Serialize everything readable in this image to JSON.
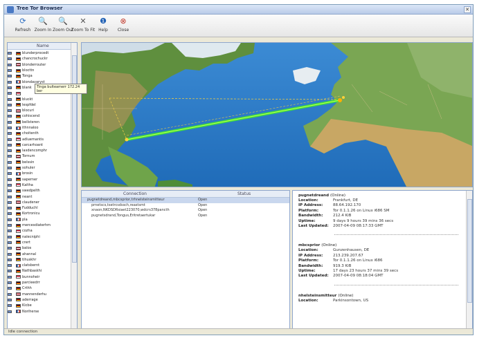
{
  "window": {
    "title": "Tree Tor Browser"
  },
  "toolbar": [
    {
      "label": "Refresh",
      "icon": "refresh-icon",
      "glyph": "⟳",
      "color": "#2e6fc2"
    },
    {
      "label": "Zoom In",
      "icon": "zoom-in-icon",
      "glyph": "🔍",
      "color": "#333"
    },
    {
      "label": "Zoom Out",
      "icon": "zoom-out-icon",
      "glyph": "🔍",
      "color": "#333"
    },
    {
      "label": "Zoom To Fit",
      "icon": "zoom-fit-icon",
      "glyph": "✕",
      "color": "#555"
    },
    {
      "label": "Help",
      "icon": "help-icon",
      "glyph": "❶",
      "color": "#1e5fb4"
    },
    {
      "label": "Close",
      "icon": "close-icon",
      "glyph": "⊗",
      "color": "#c0392b"
    }
  ],
  "routers": {
    "header": "Name",
    "items": [
      "blunderprocedt",
      "chancrochuckr",
      "blonderrouter",
      "blocttn",
      "Tonga",
      "blondavaryst",
      "blank",
      "",
      "bluckt",
      "lespfdel",
      "blocuri",
      "cohiscend",
      "bellsteren",
      "ithnnaloo",
      "choitenth",
      "adluemantis",
      "carcarhoant",
      "laxdencomphr",
      "Tornum",
      "belssin",
      "sohuler",
      "brosin",
      "saperner",
      "Kaltha",
      "swedpelth",
      "neant",
      "claudener",
      "Fudduchl",
      "Kortronicu",
      "pla",
      "mercesdiaterhm",
      "cozha",
      "nalecniphi",
      "crert",
      "balos",
      "ahannal",
      "tihuskhr",
      "clatsbernt",
      "Nathbaskhi",
      "bunnoheir",
      "parcieedrr",
      "Crthh",
      "mannenderhu",
      "aderrage",
      "Kicbe",
      "Noriherse"
    ]
  },
  "tooltip": "Tinga bulteamerr 172.24 ber",
  "connections": {
    "headers": [
      "Connection",
      "Status"
    ],
    "rows": [
      {
        "path": "pugnetdreand,mbcsprior,trhnelsteinsmitteur",
        "status": "Open"
      },
      {
        "path": "prnetscs,tsetrcsdssch,reastsmt",
        "status": "Open"
      },
      {
        "path": "xnaon,NKDSDRsiaet223070,wdcrs378pancth",
        "status": "Open"
      },
      {
        "path": "pugnetsdrand,Tongus,Eritretaertukar",
        "status": "Open"
      }
    ]
  },
  "details": [
    {
      "name": "pugnetdreand",
      "state": "(Online)",
      "fields": [
        [
          "Location:",
          "Frankfurt, DE"
        ],
        [
          "IP Address:",
          "88.64.192.170"
        ],
        [
          "Platform:",
          "Tor 0.1.1.26 on Linux i686 SM"
        ],
        [
          "Bandwidth:",
          "212.4 KiB"
        ],
        [
          "Uptime:",
          "9 days 9 hours 39 mins 36 secs"
        ],
        [
          "Last Updated:",
          "2007-04-09 08:17:33 GMT"
        ]
      ]
    },
    {
      "name": "mbcsprior",
      "state": "(Online)",
      "fields": [
        [
          "Location:",
          "Gunzenhausen, DE"
        ],
        [
          "IP Address:",
          "213.239.207.67"
        ],
        [
          "Platform:",
          "Tor 0.1.1.26 on Linux i686"
        ],
        [
          "Bandwidth:",
          "919.3 KiB"
        ],
        [
          "Uptime:",
          "17 days 23 hours 37 mins 39 secs"
        ],
        [
          "Last Updated:",
          "2007-04-09 08:18:04 GMT"
        ]
      ]
    },
    {
      "name": "nhelsteinsmitteur",
      "state": "(Online)",
      "fields": [
        [
          "Location:",
          "Parkinsontown, US"
        ]
      ]
    }
  ],
  "status": {
    "text": "Idle connection"
  }
}
